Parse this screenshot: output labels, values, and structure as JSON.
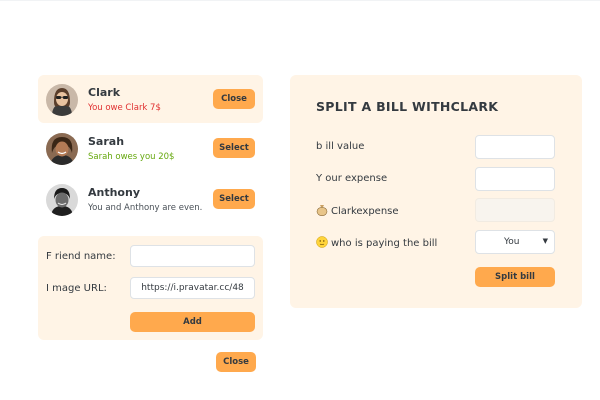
{
  "friends": [
    {
      "name": "Clark",
      "status": "You owe Clark 7$",
      "button": "Close"
    },
    {
      "name": "Sarah",
      "status": "Sarah owes you 20$",
      "button": "Select"
    },
    {
      "name": "Anthony",
      "status": "You and Anthony are even.",
      "button": "Select"
    }
  ],
  "add_friend": {
    "name_label": "F riend name:",
    "name_value": "",
    "image_label": "I mage URL:",
    "image_value": "https://i.pravatar.cc/48",
    "add_button": "Add"
  },
  "close_button": "Close",
  "split": {
    "title": "SPLIT A BILL WITHCLARK",
    "bill_label": "b ill value",
    "your_expense_label": "Y our expense",
    "friend_expense_label": "Clarkexpense",
    "payer_label": "who is paying the bill",
    "payer_selected": "You",
    "submit": "Split bill"
  },
  "colors": {
    "accent": "#ffa94d",
    "panel": "#fff4e6",
    "owe": "#e03131",
    "owed": "#66a80f"
  }
}
